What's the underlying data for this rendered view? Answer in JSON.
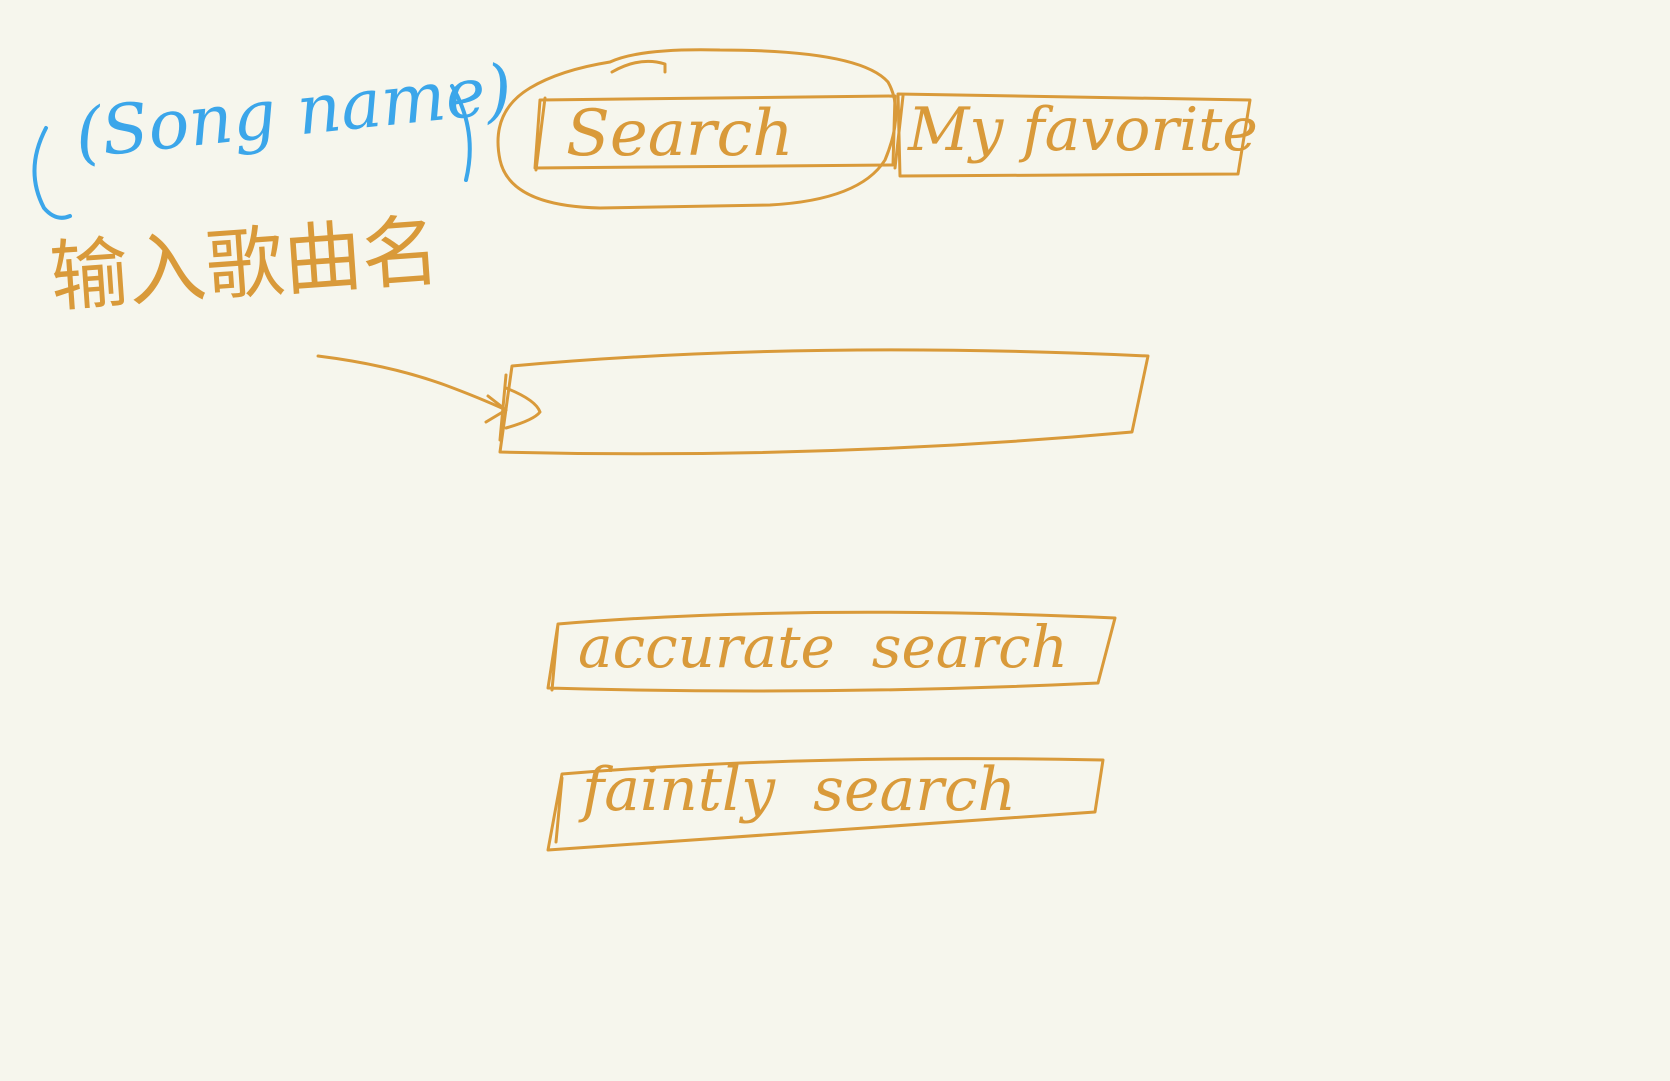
{
  "annotation": {
    "english": "(Song name)",
    "chinese": "输入歌曲名"
  },
  "tabs": {
    "search": "Search",
    "favorite": "My favorite"
  },
  "song_input": {
    "value": ""
  },
  "buttons": {
    "accurate": "accurate  search",
    "faint": "faintly  search"
  },
  "colors": {
    "background": "#f6f6ed",
    "sketch_ink": "#d99a3a",
    "annotation_ink": "#3ba6ea"
  }
}
